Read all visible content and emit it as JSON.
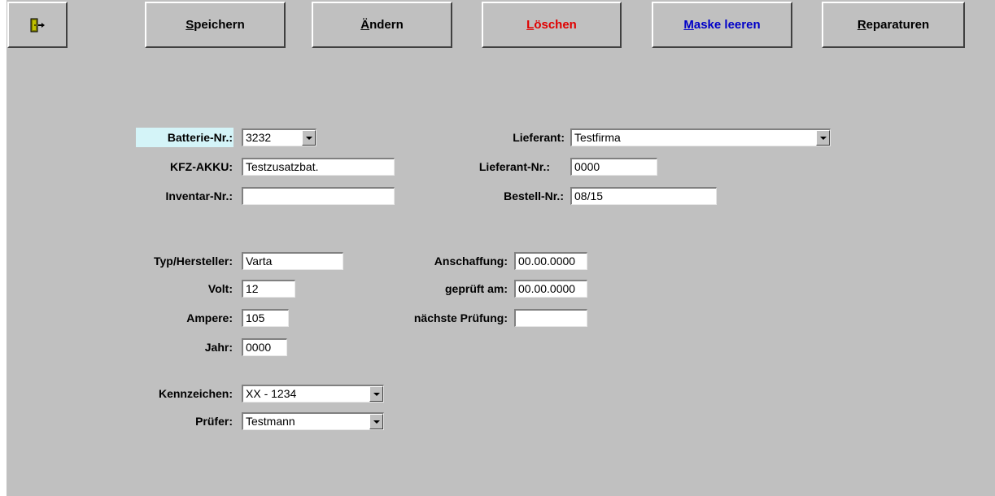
{
  "toolbar": {
    "exit_icon": "exit-door-icon",
    "buttons": [
      {
        "pre": "",
        "ul": "S",
        "post": "peichern"
      },
      {
        "pre": "",
        "ul": "Ä",
        "post": "ndern"
      },
      {
        "pre": "",
        "ul": "L",
        "post": "öschen"
      },
      {
        "pre": "",
        "ul": "M",
        "post": "aske leeren"
      },
      {
        "pre": "",
        "ul": "R",
        "post": "eparaturen"
      }
    ],
    "colors": {
      "loeschen": "#e00000",
      "maske_leeren": "#0000c8"
    }
  },
  "form": {
    "batterie_nr": {
      "label": "Batterie-Nr.:",
      "value": "3232",
      "label_bg": "#d4f4f8"
    },
    "kfz_akku": {
      "label": "KFZ-AKKU:",
      "value": "Testzusatzbat."
    },
    "inventar_nr": {
      "label": "Inventar-Nr.:",
      "value": ""
    },
    "lieferant": {
      "label": "Lieferant:",
      "value": "Testfirma"
    },
    "lieferant_nr": {
      "label": "Lieferant-Nr.:",
      "value": "0000"
    },
    "bestell_nr": {
      "label": "Bestell-Nr.:",
      "value": "08/15"
    },
    "typ_hersteller": {
      "label": "Typ/Hersteller:",
      "value": "Varta"
    },
    "volt": {
      "label": "Volt:",
      "value": "12"
    },
    "ampere": {
      "label": "Ampere:",
      "value": "105"
    },
    "jahr": {
      "label": "Jahr:",
      "value": "0000"
    },
    "anschaffung": {
      "label": "Anschaffung:",
      "value": "00.00.0000"
    },
    "geprueft_am": {
      "label": "geprüft am:",
      "value": "00.00.0000"
    },
    "naechste_pruefung": {
      "label": "nächste Prüfung:",
      "value": ""
    },
    "kennzeichen": {
      "label": "Kennzeichen:",
      "value": "XX - 1234"
    },
    "pruefer": {
      "label": "Prüfer:",
      "value": "Testmann"
    }
  }
}
